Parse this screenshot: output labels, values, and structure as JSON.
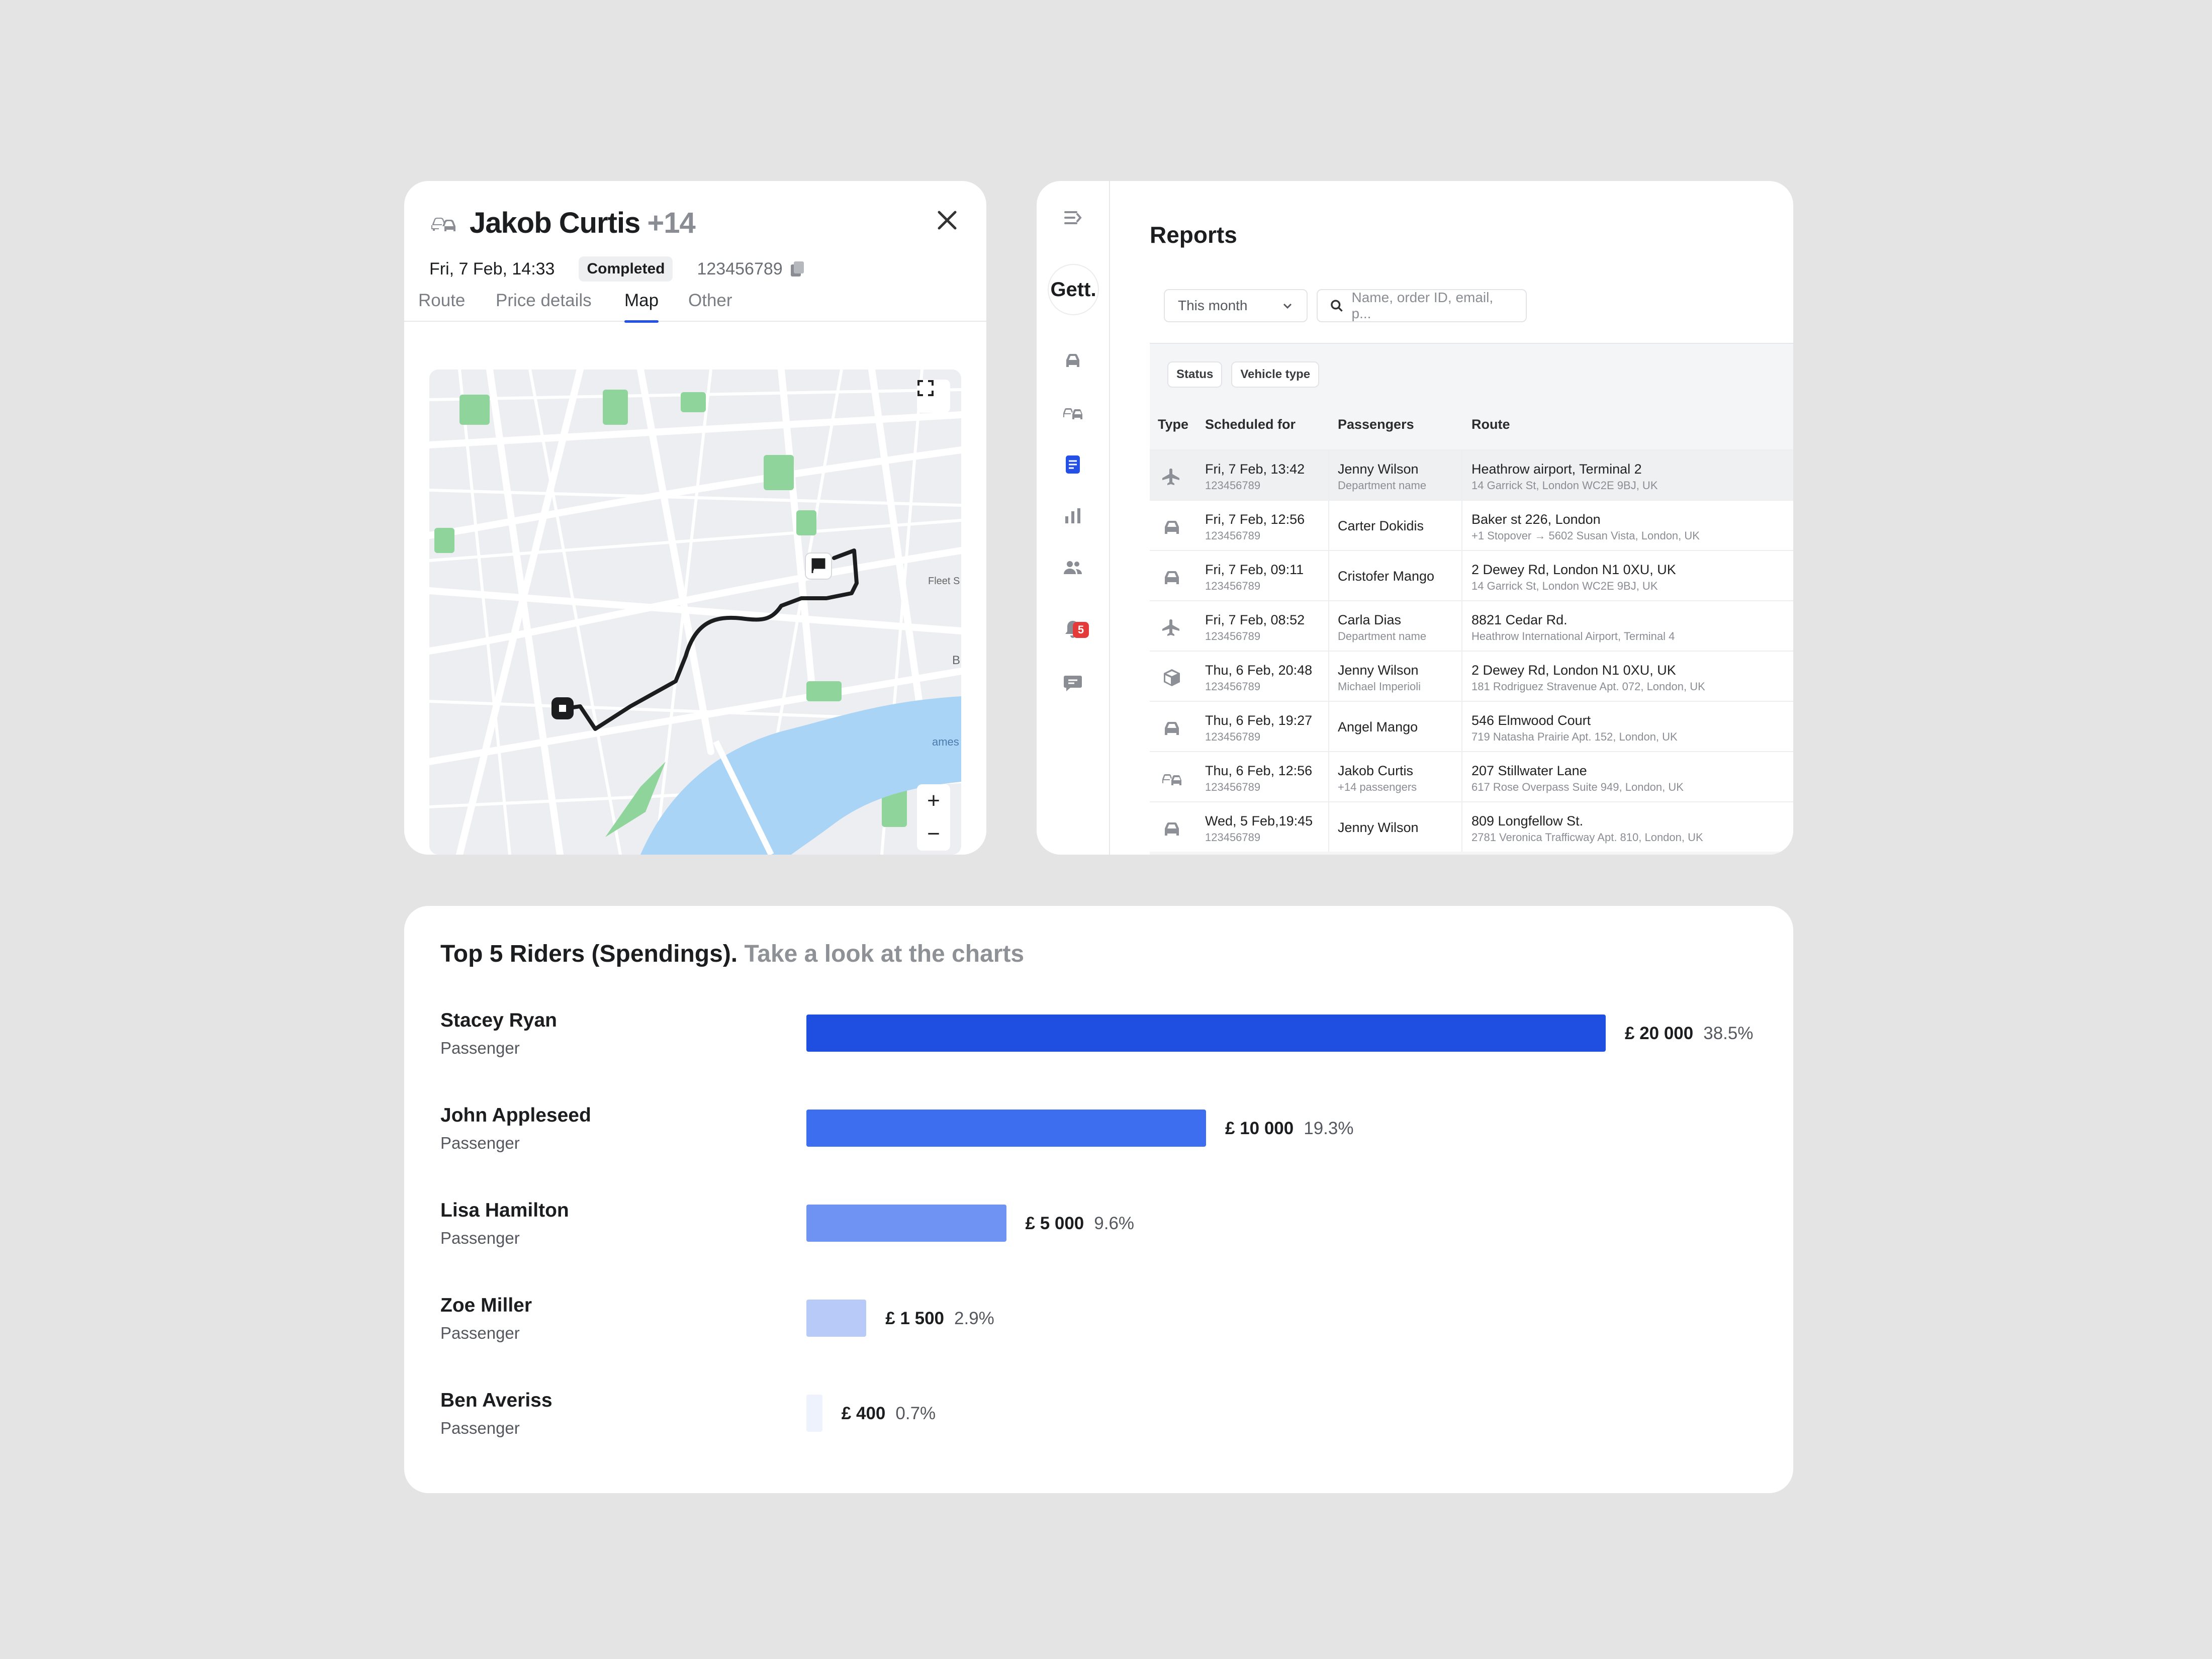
{
  "ride": {
    "name": "Jakob Curtis",
    "extra": "+14",
    "date": "Fri, 7 Feb, 14:33",
    "status": "Completed",
    "order_number": "123456789",
    "tabs": [
      "Route",
      "Price details",
      "Map",
      "Other"
    ],
    "active_tab": "Map",
    "map": {
      "labels": [
        "Fleet S",
        "ames",
        "B"
      ],
      "zoom_in": "+",
      "zoom_out": "−",
      "route_color": "#1c1d1f",
      "water_color": "#a9d4f5",
      "park_color": "#8fd49b"
    }
  },
  "reports": {
    "logo": "Gett.",
    "title": "Reports",
    "period": "This month",
    "search_placeholder": "Name, order ID, email, p...",
    "notification_count": "5",
    "filters": [
      "Status",
      "Vehicle type"
    ],
    "columns": [
      "Type",
      "Scheduled for",
      "Passengers",
      "Route"
    ],
    "rows": [
      {
        "type_icon": "plane-icon",
        "scheduled": "Fri, 7 Feb, 13:42",
        "order": "123456789",
        "passenger": "Jenny Wilson",
        "passenger_sub": "Department name",
        "route": "Heathrow airport, Terminal 2",
        "route_sub": "14 Garrick St, London WC2E 9BJ, UK"
      },
      {
        "type_icon": "car-icon",
        "scheduled": "Fri, 7 Feb, 12:56",
        "order": "123456789",
        "passenger": "Carter Dokidis",
        "passenger_sub": "",
        "route": "Baker st 226, London",
        "route_sub": "+1 Stopover → 5602 Susan Vista, London, UK"
      },
      {
        "type_icon": "car-icon",
        "scheduled": "Fri, 7 Feb, 09:11",
        "order": "123456789",
        "passenger": "Cristofer Mango",
        "passenger_sub": "",
        "route": "2 Dewey Rd, London N1 0XU, UK",
        "route_sub": "14 Garrick St, London WC2E 9BJ, UK"
      },
      {
        "type_icon": "plane-icon",
        "scheduled": "Fri, 7 Feb, 08:52",
        "order": "123456789",
        "passenger": "Carla Dias",
        "passenger_sub": "Department name",
        "route": "8821 Cedar Rd.",
        "route_sub": "Heathrow International Airport, Terminal 4"
      },
      {
        "type_icon": "box-icon",
        "scheduled": "Thu, 6 Feb, 20:48",
        "order": "123456789",
        "passenger": "Jenny Wilson",
        "passenger_sub": "Michael Imperioli",
        "route": "2 Dewey Rd, London N1 0XU, UK",
        "route_sub": "181 Rodriguez Stravenue Apt. 072, London, UK"
      },
      {
        "type_icon": "car-icon",
        "scheduled": "Thu, 6 Feb, 19:27",
        "order": "123456789",
        "passenger": "Angel Mango",
        "passenger_sub": "",
        "route": "546 Elmwood Court",
        "route_sub": "719 Natasha Prairie Apt. 152, London, UK"
      },
      {
        "type_icon": "cars-icon",
        "scheduled": "Thu, 6 Feb, 12:56",
        "order": "123456789",
        "passenger": "Jakob Curtis",
        "passenger_sub": "+14 passengers",
        "route": "207 Stillwater Lane",
        "route_sub": "617 Rose Overpass Suite 949, London, UK"
      },
      {
        "type_icon": "car-icon",
        "scheduled": "Wed, 5 Feb,19:45",
        "order": "123456789",
        "passenger": "Jenny Wilson",
        "passenger_sub": "",
        "route": "809 Longfellow St.",
        "route_sub": "2781 Veronica Trafficway Apt. 810, London, UK"
      }
    ]
  },
  "top5": {
    "title": "Top 5 Riders (Spendings).",
    "subtitle": "Take a look at the charts",
    "riders": [
      {
        "name": "Stacey Ryan",
        "role": "Passenger",
        "amount": "£ 20 000",
        "percent": "38.5%",
        "value": 20000,
        "color": "#1f4fe0"
      },
      {
        "name": "John Appleseed",
        "role": "Passenger",
        "amount": "£ 10 000",
        "percent": "19.3%",
        "value": 10000,
        "color": "#3d6ef0"
      },
      {
        "name": "Lisa Hamilton",
        "role": "Passenger",
        "amount": "£ 5 000",
        "percent": "9.6%",
        "value": 5000,
        "color": "#6f93f2"
      },
      {
        "name": "Zoe Miller",
        "role": "Passenger",
        "amount": "£ 1 500",
        "percent": "2.9%",
        "value": 1500,
        "color": "#b8cbf8"
      },
      {
        "name": "Ben Averiss",
        "role": "Passenger",
        "amount": "£ 400",
        "percent": "0.7%",
        "value": 400,
        "color": "#eef2fd"
      }
    ]
  }
}
